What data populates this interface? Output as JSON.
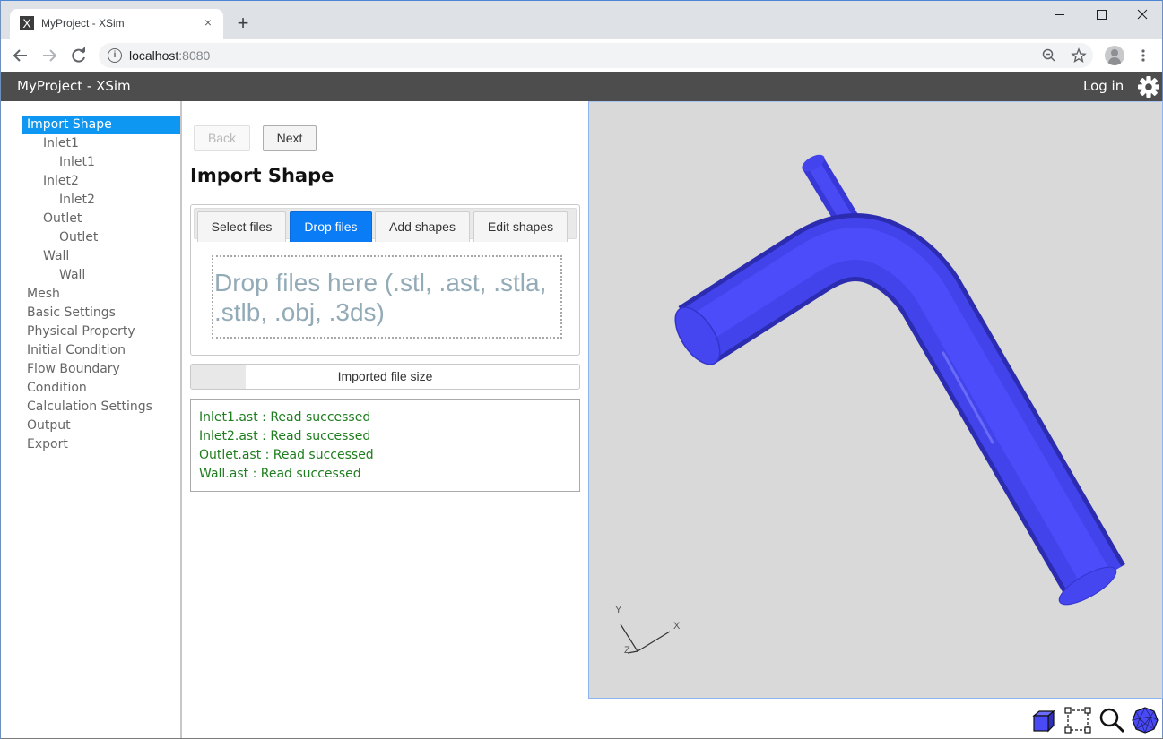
{
  "browser": {
    "tab_title": "MyProject - XSim",
    "favicon_letter": "X",
    "new_tab_symbol": "+",
    "close_symbol": "×",
    "url_host": "localhost",
    "url_port": ":8080",
    "window_controls": {
      "minimize": "—",
      "maximize": "☐",
      "close": "✕"
    }
  },
  "header": {
    "app_title": "MyProject - XSim",
    "login_label": "Log in"
  },
  "sidebar": {
    "items": [
      {
        "label": "Import Shape",
        "level": 0,
        "active": true
      },
      {
        "label": "Inlet1",
        "level": 1
      },
      {
        "label": "Inlet1",
        "level": 2
      },
      {
        "label": "Inlet2",
        "level": 1
      },
      {
        "label": "Inlet2",
        "level": 2
      },
      {
        "label": "Outlet",
        "level": 1
      },
      {
        "label": "Outlet",
        "level": 2
      },
      {
        "label": "Wall",
        "level": 1
      },
      {
        "label": "Wall",
        "level": 2
      },
      {
        "label": "Mesh",
        "level": 0
      },
      {
        "label": "Basic Settings",
        "level": 0
      },
      {
        "label": "Physical Property",
        "level": 0
      },
      {
        "label": "Initial Condition",
        "level": 0
      },
      {
        "label": "Flow Boundary",
        "level": 0
      },
      {
        "label": "Condition",
        "level": 0
      },
      {
        "label": "Calculation Settings",
        "level": 0
      },
      {
        "label": "Output",
        "level": 0
      },
      {
        "label": "Export",
        "level": 0
      }
    ]
  },
  "main": {
    "back_label": "Back",
    "next_label": "Next",
    "title": "Import Shape",
    "tabs": [
      {
        "label": "Select files",
        "active": false
      },
      {
        "label": "Drop files",
        "active": true
      },
      {
        "label": "Add shapes",
        "active": false
      },
      {
        "label": "Edit shapes",
        "active": false
      }
    ],
    "drop_text": "Drop files here (.stl, .ast, .stla, .stlb, .obj, .3ds)",
    "progress": {
      "label": "Imported file size",
      "fraction": 0.14
    },
    "log": [
      "Inlet1.ast : Read successed",
      "Inlet2.ast : Read successed",
      "Outlet.ast : Read successed",
      "Wall.ast : Read successed"
    ]
  },
  "viewport": {
    "background": "#d9d9d9",
    "model_color": "#4a4af5",
    "axis_labels": {
      "x": "X",
      "y": "Y",
      "z": "Z"
    },
    "tools": [
      "view-cube-icon",
      "box-select-icon",
      "zoom-icon",
      "wireframe-sphere-icon"
    ]
  }
}
